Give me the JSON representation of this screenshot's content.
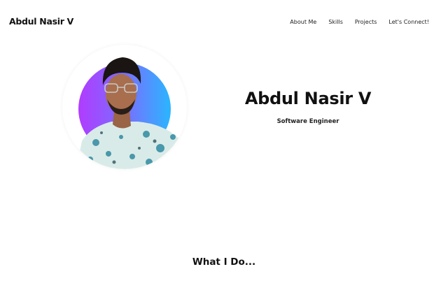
{
  "nav": {
    "brand": "Abdul Nasir V",
    "links": [
      {
        "label": "About Me"
      },
      {
        "label": "Skills"
      },
      {
        "label": "Projects"
      },
      {
        "label": "Let's Connect!"
      }
    ]
  },
  "hero": {
    "name": "Abdul Nasir V",
    "role": "Software Engineer",
    "avatar_gradient": [
      "#b13cff",
      "#2ab6ff"
    ]
  },
  "section": {
    "title": "What I Do..."
  }
}
